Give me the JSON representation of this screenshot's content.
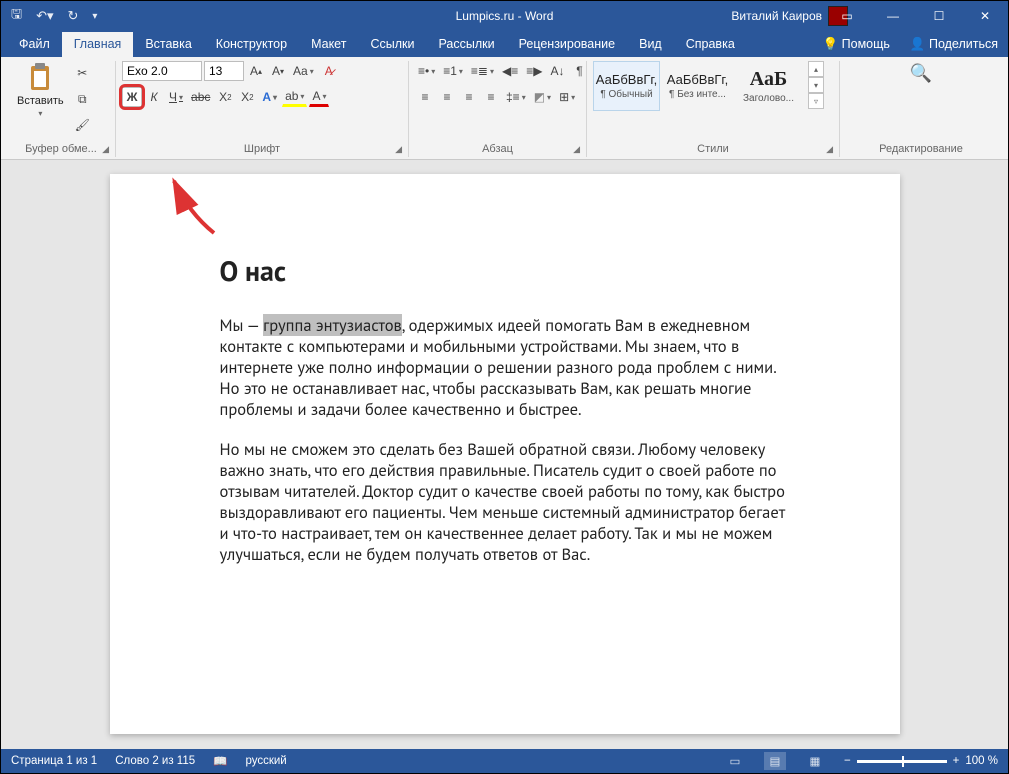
{
  "titlebar": {
    "title": "Lumpics.ru - Word",
    "user": "Виталий Каиров"
  },
  "tabs": {
    "file": "Файл",
    "home": "Главная",
    "insert": "Вставка",
    "design": "Конструктор",
    "layout": "Макет",
    "references": "Ссылки",
    "mailings": "Рассылки",
    "review": "Рецензирование",
    "view": "Вид",
    "help": "Справка",
    "search": "Помощь",
    "share": "Поделиться"
  },
  "ribbon": {
    "clipboard": {
      "label": "Буфер обме...",
      "paste": "Вставить"
    },
    "font": {
      "label": "Шрифт",
      "name": "Exo 2.0",
      "size": "13",
      "bold": "Ж",
      "italic": "К",
      "underline": "Ч",
      "strike": "abc",
      "sub": "X",
      "sup": "X",
      "grow": "A",
      "shrink": "A",
      "case": "Aa",
      "clear": "A",
      "effects": "A",
      "highlight": "ab",
      "color": "A"
    },
    "para": {
      "label": "Абзац"
    },
    "styles": {
      "label": "Стили",
      "s1": {
        "prev": "АаБбВвГг,",
        "name": "¶ Обычный"
      },
      "s2": {
        "prev": "АаБбВвГг,",
        "name": "¶ Без инте..."
      },
      "s3": {
        "prev": "АаБ",
        "name": "Заголово..."
      }
    },
    "editing": {
      "label": "Редактирование"
    }
  },
  "doc": {
    "heading": "О нас",
    "p1a": "Мы — ",
    "p1sel": "группа энтузиастов",
    "p1b": ", одержимых идеей помогать Вам в ежедневном контакте с компьютерами и мобильными устройствами. Мы знаем, что в интернете уже полно информации о решении разного рода проблем с ними. Но это не останавливает нас, чтобы рассказывать Вам, как решать многие проблемы и задачи более качественно и быстрее.",
    "p2": "Но мы не сможем это сделать без Вашей обратной связи. Любому человеку важно знать, что его действия правильные. Писатель судит о своей работе по отзывам читателей. Доктор судит о качестве своей работы по тому, как быстро выздоравливают его пациенты. Чем меньше системный администратор бегает и что-то настраивает, тем он качественнее делает работу. Так и мы не можем улучшаться, если не будем получать ответов от Вас."
  },
  "status": {
    "page": "Страница 1 из 1",
    "words": "Слово 2 из 115",
    "lang": "русский",
    "zoom": "100 %"
  }
}
